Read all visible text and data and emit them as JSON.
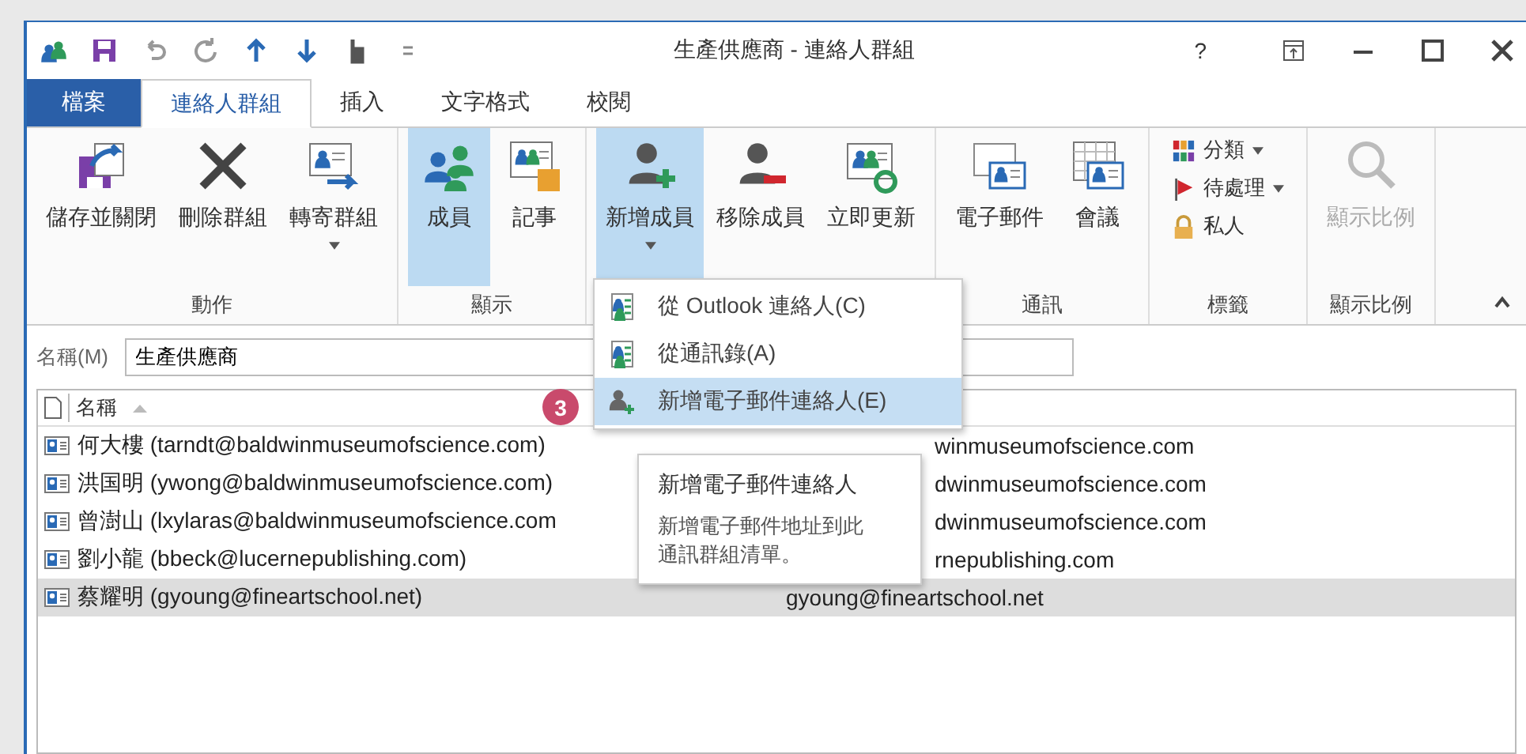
{
  "window": {
    "title": "生產供應商 - 連絡人群組",
    "help": "?"
  },
  "tabs": [
    {
      "label": "檔案",
      "kind": "file",
      "selected": false
    },
    {
      "label": "連絡人群組",
      "kind": "tab",
      "selected": true
    },
    {
      "label": "插入",
      "kind": "tab",
      "selected": false
    },
    {
      "label": "文字格式",
      "kind": "tab",
      "selected": false
    },
    {
      "label": "校閱",
      "kind": "tab",
      "selected": false
    }
  ],
  "ribbon": {
    "groups": [
      {
        "label": "動作",
        "buttons": [
          {
            "label": "儲存並關閉",
            "kind": "save",
            "selected": false
          },
          {
            "label": "刪除群組",
            "kind": "delete",
            "selected": false
          },
          {
            "label": "轉寄群組",
            "kind": "forward",
            "selected": false,
            "has_menu": true
          }
        ]
      },
      {
        "label": "顯示",
        "buttons": [
          {
            "label": "成員",
            "kind": "members",
            "selected": true
          },
          {
            "label": "記事",
            "kind": "notes",
            "selected": false
          }
        ]
      },
      {
        "buttons": [
          {
            "label": "新增成員",
            "kind": "add",
            "selected": true,
            "has_menu": true
          },
          {
            "label": "移除成員",
            "kind": "remove",
            "selected": false
          },
          {
            "label": "立即更新",
            "kind": "update",
            "selected": false
          }
        ]
      },
      {
        "label": "通訊",
        "buttons": [
          {
            "label": "電子郵件",
            "kind": "email",
            "selected": false
          },
          {
            "label": "會議",
            "kind": "meeting",
            "selected": false
          }
        ]
      },
      {
        "label": "標籤",
        "small": [
          {
            "label": "分類",
            "kind": "categorize",
            "has_menu": true
          },
          {
            "label": "待處理",
            "kind": "flag",
            "has_menu": true
          },
          {
            "label": "私人",
            "kind": "lock"
          }
        ]
      },
      {
        "label": "顯示比例",
        "buttons": [
          {
            "label": "顯示比例",
            "kind": "zoom",
            "selected": false,
            "disabled": true
          }
        ]
      }
    ]
  },
  "name_field": {
    "label": "名稱(M)",
    "value": "生產供應商"
  },
  "list": {
    "columns": [
      {
        "label": "名稱"
      }
    ],
    "rows": [
      {
        "name": "何大樓 (tarndt@baldwinmuseumofscience.com)",
        "email": "winmuseumofscience.com",
        "selected": false
      },
      {
        "name": "洪国明 (ywong@baldwinmuseumofscience.com)",
        "email": "dwinmuseumofscience.com",
        "selected": false
      },
      {
        "name": "曾澍山 (lxylaras@baldwinmuseumofscience.com",
        "email": "dwinmuseumofscience.com",
        "selected": false
      },
      {
        "name": "劉小龍 (bbeck@lucernepublishing.com)",
        "email": "rnepublishing.com",
        "selected": false
      },
      {
        "name": "蔡耀明 (gyoung@fineartschool.net)",
        "email": "gyoung@fineartschool.net",
        "selected": true
      }
    ]
  },
  "dropdown": {
    "items": [
      {
        "label": "從 Outlook 連絡人(C)",
        "kind": "book",
        "selected": false
      },
      {
        "label": "從通訊錄(A)",
        "kind": "book",
        "selected": false
      },
      {
        "label": "新增電子郵件連絡人(E)",
        "kind": "person",
        "selected": true
      }
    ]
  },
  "step_badge": "3",
  "tooltip": {
    "title": "新增電子郵件連絡人",
    "text": "新增電子郵件地址到此通訊群組清單。"
  }
}
